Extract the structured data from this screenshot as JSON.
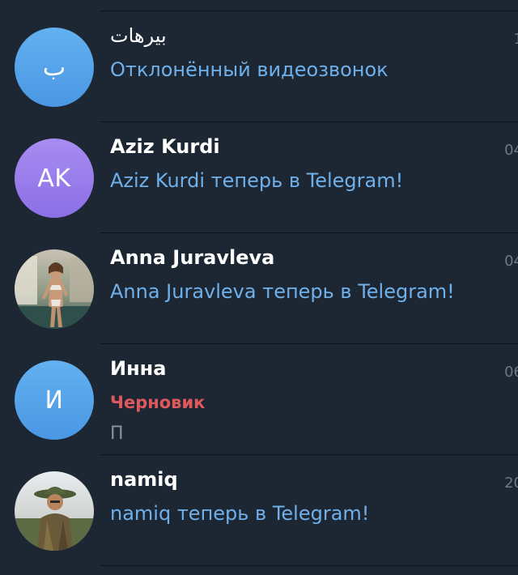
{
  "chats": [
    {
      "name": "بيرهات",
      "avatar_letters": "ب",
      "avatar_color": "#5aa6ec",
      "preview": "Отклонённый видеозвонок",
      "time": "1"
    },
    {
      "name": "Aziz Kurdi",
      "avatar_letters": "AK",
      "avatar_color": "#9b7ff0",
      "preview": "Aziz Kurdi теперь в Telegram!",
      "time": "04"
    },
    {
      "name": "Anna Juravleva",
      "avatar_letters": "",
      "avatar_color": "",
      "preview": "Anna Juravleva теперь в Telegram!",
      "time": "04"
    },
    {
      "name": "Инна",
      "avatar_letters": "И",
      "avatar_color": "#5aa6ec",
      "draft_label": "Черновик",
      "preview_line2": "П",
      "time": "06"
    },
    {
      "name": "namiq",
      "avatar_letters": "",
      "avatar_color": "",
      "preview": "namiq теперь в Telegram!",
      "time": "20"
    }
  ],
  "colors": {
    "background": "#1d2733",
    "name_text": "#ffffff",
    "preview_text": "#6fb0ea",
    "draft_text": "#e0575c",
    "time_text": "#6d7883",
    "divider": "#0f151c"
  }
}
